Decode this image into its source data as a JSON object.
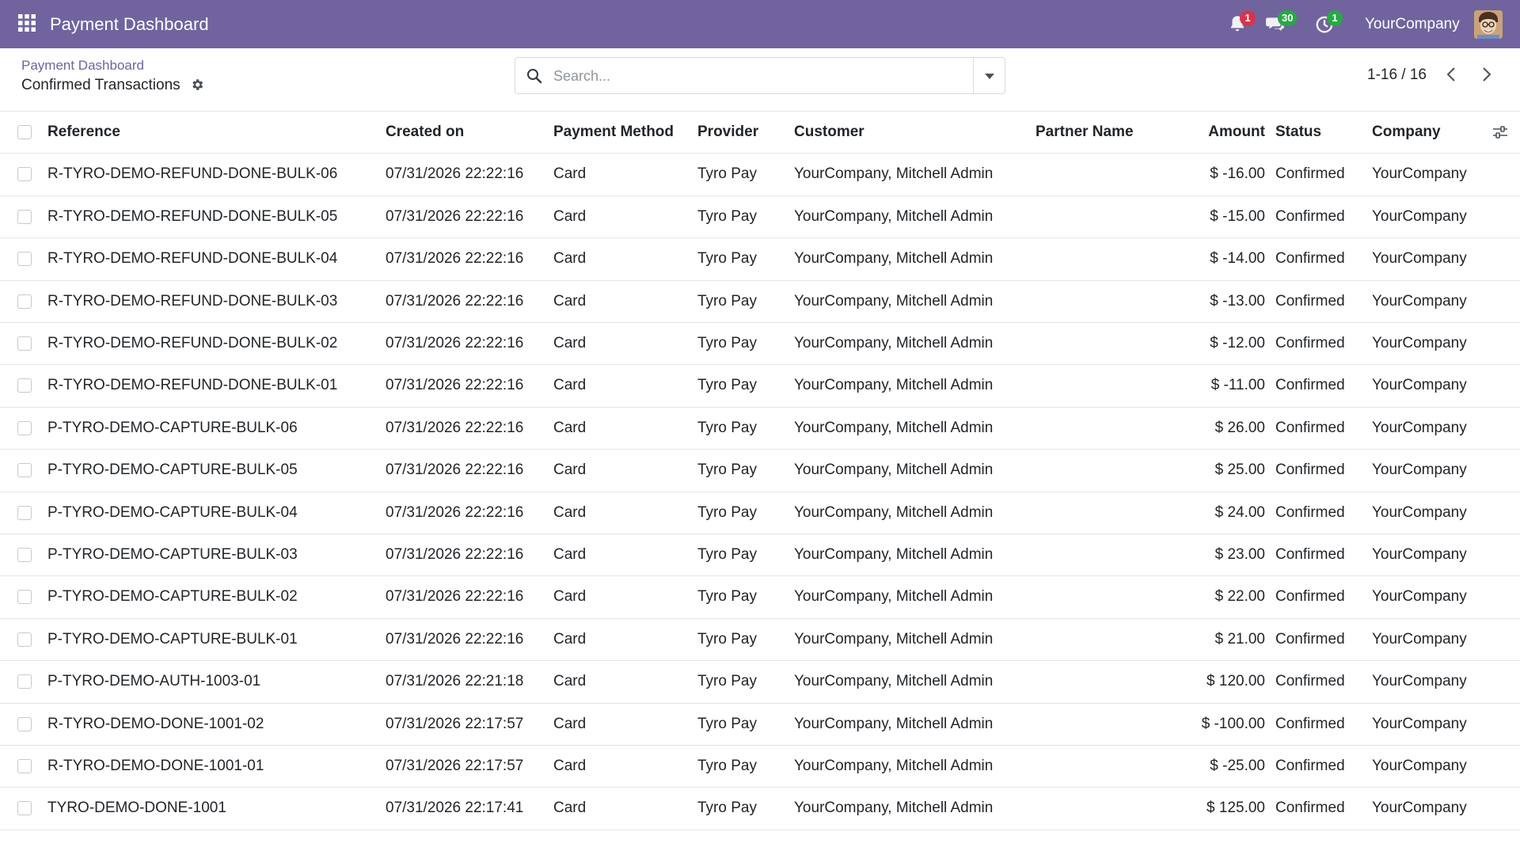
{
  "navbar": {
    "app_title": "Payment Dashboard",
    "activity_badge": "1",
    "messages_badge": "30",
    "timer_badge": "1",
    "company": "YourCompany"
  },
  "control_panel": {
    "breadcrumb": "Payment Dashboard",
    "title": "Confirmed Transactions",
    "search_placeholder": "Search...",
    "pager": "1-16 / 16"
  },
  "table": {
    "headers": {
      "reference": "Reference",
      "created_on": "Created on",
      "payment_method": "Payment Method",
      "provider": "Provider",
      "customer": "Customer",
      "partner_name": "Partner Name",
      "amount": "Amount",
      "status": "Status",
      "company": "Company"
    },
    "rows": [
      {
        "reference": "R-TYRO-DEMO-REFUND-DONE-BULK-06",
        "created_on": "07/31/2026 22:22:16",
        "payment_method": "Card",
        "provider": "Tyro Pay",
        "customer": "YourCompany, Mitchell Admin",
        "partner_name": "",
        "amount": "$ -16.00",
        "status": "Confirmed",
        "company": "YourCompany"
      },
      {
        "reference": "R-TYRO-DEMO-REFUND-DONE-BULK-05",
        "created_on": "07/31/2026 22:22:16",
        "payment_method": "Card",
        "provider": "Tyro Pay",
        "customer": "YourCompany, Mitchell Admin",
        "partner_name": "",
        "amount": "$ -15.00",
        "status": "Confirmed",
        "company": "YourCompany"
      },
      {
        "reference": "R-TYRO-DEMO-REFUND-DONE-BULK-04",
        "created_on": "07/31/2026 22:22:16",
        "payment_method": "Card",
        "provider": "Tyro Pay",
        "customer": "YourCompany, Mitchell Admin",
        "partner_name": "",
        "amount": "$ -14.00",
        "status": "Confirmed",
        "company": "YourCompany"
      },
      {
        "reference": "R-TYRO-DEMO-REFUND-DONE-BULK-03",
        "created_on": "07/31/2026 22:22:16",
        "payment_method": "Card",
        "provider": "Tyro Pay",
        "customer": "YourCompany, Mitchell Admin",
        "partner_name": "",
        "amount": "$ -13.00",
        "status": "Confirmed",
        "company": "YourCompany"
      },
      {
        "reference": "R-TYRO-DEMO-REFUND-DONE-BULK-02",
        "created_on": "07/31/2026 22:22:16",
        "payment_method": "Card",
        "provider": "Tyro Pay",
        "customer": "YourCompany, Mitchell Admin",
        "partner_name": "",
        "amount": "$ -12.00",
        "status": "Confirmed",
        "company": "YourCompany"
      },
      {
        "reference": "R-TYRO-DEMO-REFUND-DONE-BULK-01",
        "created_on": "07/31/2026 22:22:16",
        "payment_method": "Card",
        "provider": "Tyro Pay",
        "customer": "YourCompany, Mitchell Admin",
        "partner_name": "",
        "amount": "$ -11.00",
        "status": "Confirmed",
        "company": "YourCompany"
      },
      {
        "reference": "P-TYRO-DEMO-CAPTURE-BULK-06",
        "created_on": "07/31/2026 22:22:16",
        "payment_method": "Card",
        "provider": "Tyro Pay",
        "customer": "YourCompany, Mitchell Admin",
        "partner_name": "",
        "amount": "$ 26.00",
        "status": "Confirmed",
        "company": "YourCompany"
      },
      {
        "reference": "P-TYRO-DEMO-CAPTURE-BULK-05",
        "created_on": "07/31/2026 22:22:16",
        "payment_method": "Card",
        "provider": "Tyro Pay",
        "customer": "YourCompany, Mitchell Admin",
        "partner_name": "",
        "amount": "$ 25.00",
        "status": "Confirmed",
        "company": "YourCompany"
      },
      {
        "reference": "P-TYRO-DEMO-CAPTURE-BULK-04",
        "created_on": "07/31/2026 22:22:16",
        "payment_method": "Card",
        "provider": "Tyro Pay",
        "customer": "YourCompany, Mitchell Admin",
        "partner_name": "",
        "amount": "$ 24.00",
        "status": "Confirmed",
        "company": "YourCompany"
      },
      {
        "reference": "P-TYRO-DEMO-CAPTURE-BULK-03",
        "created_on": "07/31/2026 22:22:16",
        "payment_method": "Card",
        "provider": "Tyro Pay",
        "customer": "YourCompany, Mitchell Admin",
        "partner_name": "",
        "amount": "$ 23.00",
        "status": "Confirmed",
        "company": "YourCompany"
      },
      {
        "reference": "P-TYRO-DEMO-CAPTURE-BULK-02",
        "created_on": "07/31/2026 22:22:16",
        "payment_method": "Card",
        "provider": "Tyro Pay",
        "customer": "YourCompany, Mitchell Admin",
        "partner_name": "",
        "amount": "$ 22.00",
        "status": "Confirmed",
        "company": "YourCompany"
      },
      {
        "reference": "P-TYRO-DEMO-CAPTURE-BULK-01",
        "created_on": "07/31/2026 22:22:16",
        "payment_method": "Card",
        "provider": "Tyro Pay",
        "customer": "YourCompany, Mitchell Admin",
        "partner_name": "",
        "amount": "$ 21.00",
        "status": "Confirmed",
        "company": "YourCompany"
      },
      {
        "reference": "P-TYRO-DEMO-AUTH-1003-01",
        "created_on": "07/31/2026 22:21:18",
        "payment_method": "Card",
        "provider": "Tyro Pay",
        "customer": "YourCompany, Mitchell Admin",
        "partner_name": "",
        "amount": "$ 120.00",
        "status": "Confirmed",
        "company": "YourCompany"
      },
      {
        "reference": "R-TYRO-DEMO-DONE-1001-02",
        "created_on": "07/31/2026 22:17:57",
        "payment_method": "Card",
        "provider": "Tyro Pay",
        "customer": "YourCompany, Mitchell Admin",
        "partner_name": "",
        "amount": "$ -100.00",
        "status": "Confirmed",
        "company": "YourCompany"
      },
      {
        "reference": "R-TYRO-DEMO-DONE-1001-01",
        "created_on": "07/31/2026 22:17:57",
        "payment_method": "Card",
        "provider": "Tyro Pay",
        "customer": "YourCompany, Mitchell Admin",
        "partner_name": "",
        "amount": "$ -25.00",
        "status": "Confirmed",
        "company": "YourCompany"
      },
      {
        "reference": "TYRO-DEMO-DONE-1001",
        "created_on": "07/31/2026 22:17:41",
        "payment_method": "Card",
        "provider": "Tyro Pay",
        "customer": "YourCompany, Mitchell Admin",
        "partner_name": "",
        "amount": "$ 125.00",
        "status": "Confirmed",
        "company": "YourCompany"
      }
    ]
  },
  "colors": {
    "navbar": "#71639e",
    "link": "#71639e",
    "badge_red": "#d9334a",
    "badge_green": "#28a745",
    "row_border": "#e3e5e8"
  },
  "icons": {
    "apps": "apps-grid-icon",
    "activity": "bell-icon",
    "messages": "chat-icon",
    "timer": "clock-icon",
    "settings": "gear-icon",
    "search": "search-icon",
    "search_options": "caret-down-icon",
    "prev": "chevron-left-icon",
    "next": "chevron-right-icon",
    "column_options": "sliders-icon"
  }
}
